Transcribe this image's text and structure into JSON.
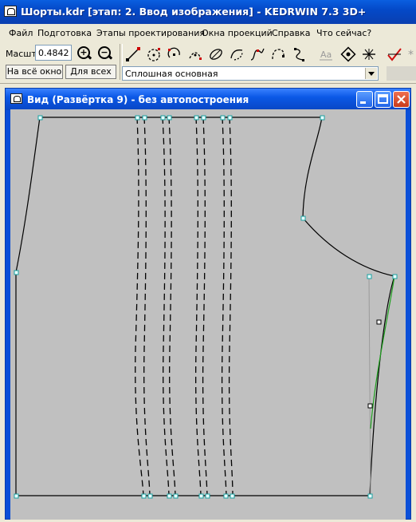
{
  "window": {
    "title": "Шорты.kdr [этап: 2. Ввод изображения] - KEDRWIN 7.3 3D+"
  },
  "menu": [
    "Файл",
    "Подготовка",
    "Этапы проектирования",
    "Окна проекций",
    "Справка",
    "Что сейчас?"
  ],
  "toolbar": {
    "scale_label": "Масшт",
    "scale_value": "0.4842",
    "fit_window_label": "На всё окно",
    "for_all_label": "Для всех",
    "line_type_value": "Сплошная основная"
  },
  "child_window": {
    "title": "Вид (Развёртка 9) - без автопостроения"
  },
  "colors": {
    "canvas": "#c0c0c0",
    "title_blue": "#0b58e6",
    "point": "#3cc8c8",
    "accent_green": "#20a020"
  }
}
